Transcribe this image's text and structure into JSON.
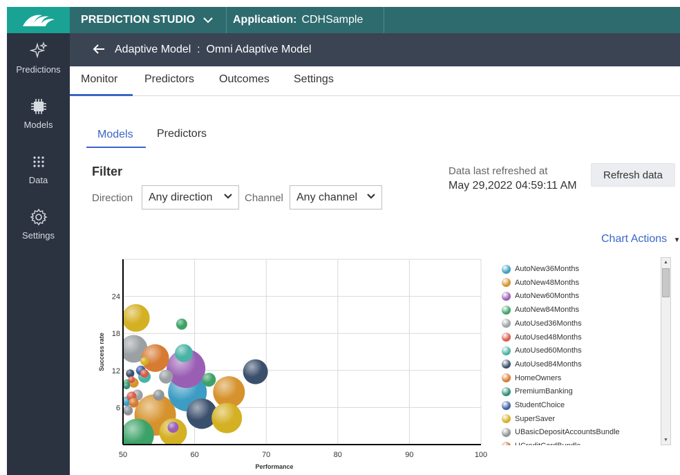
{
  "topbar": {
    "studio_title": "PREDICTION STUDIO",
    "app_label": "Application:",
    "app_name": "CDHSample"
  },
  "leftnav": {
    "items": [
      {
        "label": "Predictions",
        "icon": "sparkle-icon"
      },
      {
        "label": "Models",
        "icon": "chip-icon"
      },
      {
        "label": "Data",
        "icon": "grid-dots-icon"
      },
      {
        "label": "Settings",
        "icon": "gear-icon"
      }
    ]
  },
  "header": {
    "title": "Adaptive Model  :  Omni Adaptive Model"
  },
  "tabs": [
    "Monitor",
    "Predictors",
    "Outcomes",
    "Settings"
  ],
  "active_tab": "Monitor",
  "subtabs": [
    "Models",
    "Predictors"
  ],
  "active_subtab": "Models",
  "filter": {
    "title": "Filter",
    "direction_label": "Direction",
    "direction_value": "Any direction",
    "channel_label": "Channel",
    "channel_value": "Any channel"
  },
  "refresh": {
    "label": "Data last refreshed at",
    "value": "May 29,2022 04:59:11 AM",
    "button": "Refresh data"
  },
  "chart_actions": "Chart Actions",
  "chart_data": {
    "type": "scatter",
    "xlabel": "Performance",
    "ylabel": "Success rate",
    "xlim": [
      50,
      100
    ],
    "ylim": [
      0,
      30
    ],
    "xticks": [
      50,
      60,
      70,
      80,
      90,
      100
    ],
    "yticks": [
      6,
      12,
      18,
      24
    ],
    "grid": true,
    "legend_placement": "right",
    "series": [
      {
        "name": "AutoNew36Months",
        "color": "#3d9cc4",
        "points": [
          [
            59,
            8.5,
            28
          ],
          [
            50.5,
            7,
            7
          ]
        ]
      },
      {
        "name": "AutoNew48Months",
        "color": "#d6922c",
        "points": [
          [
            54.5,
            4.8,
            30
          ],
          [
            64.8,
            8.5,
            23
          ],
          [
            51.5,
            10,
            7
          ]
        ]
      },
      {
        "name": "AutoNew60Months",
        "color": "#9a5fb4",
        "points": [
          [
            58.8,
            12.3,
            28
          ],
          [
            57,
            2.8,
            8
          ]
        ]
      },
      {
        "name": "AutoNew84Months",
        "color": "#3da268",
        "points": [
          [
            58.2,
            19.5,
            8
          ],
          [
            52,
            1.5,
            24
          ],
          [
            62,
            10.5,
            10
          ],
          [
            50.5,
            10,
            5
          ]
        ]
      },
      {
        "name": "AutoUsed36Months",
        "color": "#9aa0a3",
        "points": [
          [
            51.5,
            15.5,
            20
          ],
          [
            56,
            11,
            10
          ],
          [
            52,
            8,
            8
          ]
        ]
      },
      {
        "name": "AutoUsed48Months",
        "color": "#d75a48",
        "points": [
          [
            51.2,
            7.8,
            7
          ],
          [
            53,
            11.5,
            6
          ],
          [
            51.2,
            10.5,
            5
          ]
        ]
      },
      {
        "name": "AutoUsed60Months",
        "color": "#49b3a5",
        "points": [
          [
            58.5,
            14.8,
            13
          ],
          [
            53,
            11,
            9
          ]
        ]
      },
      {
        "name": "AutoUsed84Months",
        "color": "#3a4f6b",
        "points": [
          [
            61,
            5,
            22
          ],
          [
            68.5,
            11.8,
            18
          ],
          [
            51,
            11.5,
            6
          ]
        ]
      },
      {
        "name": "HomeOwners",
        "color": "#d77a32",
        "points": [
          [
            54.5,
            14,
            20
          ],
          [
            51.5,
            6.8,
            7
          ]
        ]
      },
      {
        "name": "PremiumBanking",
        "color": "#2e8f78",
        "points": [
          [
            50.5,
            9.5,
            5
          ]
        ]
      },
      {
        "name": "StudentChoice",
        "color": "#3b5fa0",
        "points": [
          [
            52.5,
            12,
            7
          ]
        ]
      },
      {
        "name": "SuperSaver",
        "color": "#d4b023",
        "points": [
          [
            51.8,
            20.5,
            20
          ],
          [
            64.5,
            4.3,
            22
          ],
          [
            57,
            2,
            20
          ],
          [
            53,
            13.5,
            6
          ]
        ]
      },
      {
        "name": "UBasicDepositAccountsBundle",
        "color": "#8e9396",
        "points": [
          [
            50.7,
            5.5,
            7
          ],
          [
            55,
            8,
            8
          ]
        ]
      },
      {
        "name": "UCreditCardBundle",
        "color": "#c9703a",
        "points": []
      }
    ]
  }
}
